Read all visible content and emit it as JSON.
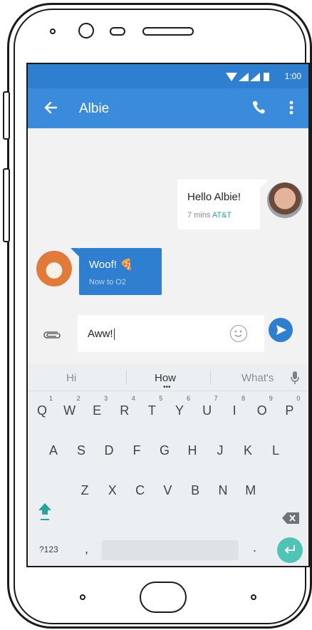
{
  "status": {
    "time": "1:00"
  },
  "contact": {
    "name": "Albie"
  },
  "messages": [
    {
      "text": "Hello Albie!",
      "time": "7 mins",
      "carrier": "AT&T"
    },
    {
      "text": "Woof! 🍕",
      "time": "Now to O2"
    }
  ],
  "composer": {
    "value": "Aww!"
  },
  "keyboard": {
    "suggestions": [
      "Hi",
      "How",
      "What's"
    ],
    "row1": [
      {
        "k": "Q",
        "n": "1"
      },
      {
        "k": "W",
        "n": "2"
      },
      {
        "k": "E",
        "n": "3"
      },
      {
        "k": "R",
        "n": "4"
      },
      {
        "k": "T",
        "n": "5"
      },
      {
        "k": "Y",
        "n": "6"
      },
      {
        "k": "U",
        "n": "7"
      },
      {
        "k": "I",
        "n": "8"
      },
      {
        "k": "O",
        "n": "9"
      },
      {
        "k": "P",
        "n": "0"
      }
    ],
    "row2": [
      "A",
      "S",
      "D",
      "F",
      "G",
      "H",
      "J",
      "K",
      "L"
    ],
    "row3": [
      "Z",
      "X",
      "C",
      "V",
      "B",
      "N",
      "M"
    ],
    "symbols": "?123",
    "comma": ",",
    "period": "."
  },
  "colors": {
    "appbar": "#3a8bdc",
    "statusbar": "#2f7fd1",
    "accent": "#2aa3a0",
    "enter": "#4fc3b6"
  }
}
